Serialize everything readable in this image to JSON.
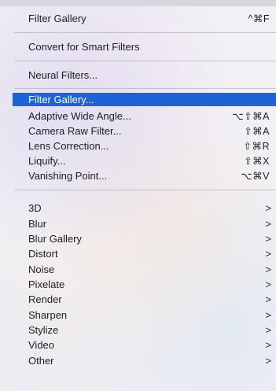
{
  "menu": {
    "top_items": [
      {
        "label": "Filter Gallery",
        "shortcut": "^⌘F"
      },
      {
        "label": "Convert for Smart Filters"
      },
      {
        "label": "Neural Filters..."
      }
    ],
    "filter_items": [
      {
        "label": "Filter Gallery...",
        "highlighted": true
      },
      {
        "label": "Adaptive Wide Angle...",
        "shortcut": "⌥⇧⌘A"
      },
      {
        "label": "Camera Raw Filter...",
        "shortcut": "⇧⌘A"
      },
      {
        "label": "Lens Correction...",
        "shortcut": "⇧⌘R"
      },
      {
        "label": "Liquify...",
        "shortcut": "⇧⌘X"
      },
      {
        "label": "Vanishing Point...",
        "shortcut": "⌥⌘V"
      }
    ],
    "submenus": [
      {
        "label": "3D"
      },
      {
        "label": "Blur"
      },
      {
        "label": "Blur Gallery"
      },
      {
        "label": "Distort"
      },
      {
        "label": "Noise"
      },
      {
        "label": "Pixelate"
      },
      {
        "label": "Render"
      },
      {
        "label": "Sharpen"
      },
      {
        "label": "Stylize"
      },
      {
        "label": "Video"
      },
      {
        "label": "Other"
      }
    ],
    "chevron": ">",
    "highlight_color": "#1b64d8"
  }
}
